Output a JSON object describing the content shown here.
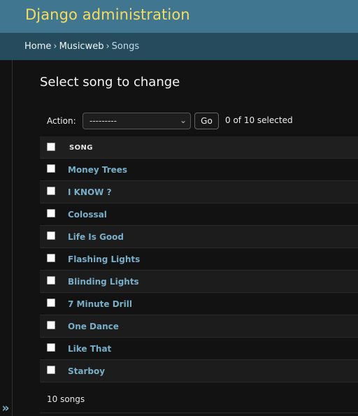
{
  "header": {
    "site_title": "Django administration"
  },
  "breadcrumbs": {
    "home": "Home",
    "sep1": "›",
    "app": "Musicweb",
    "sep2": "›",
    "current": "Songs"
  },
  "sidebar": {
    "toggle_glyph": "»"
  },
  "page": {
    "title": "Select song to change"
  },
  "actions": {
    "label": "Action:",
    "selected_option": "---------",
    "go_label": "Go",
    "selection_counter": "0 of 10 selected"
  },
  "table": {
    "column_header": "SONG",
    "rows": [
      {
        "title": "Money Trees"
      },
      {
        "title": "I KNOW ?"
      },
      {
        "title": "Colossal"
      },
      {
        "title": "Life Is Good"
      },
      {
        "title": "Flashing Lights"
      },
      {
        "title": "Blinding Lights"
      },
      {
        "title": "7 Minute Drill"
      },
      {
        "title": "One Dance"
      },
      {
        "title": "Like That"
      },
      {
        "title": "Starboy"
      }
    ]
  },
  "paginator": {
    "text": "10 songs"
  },
  "colors": {
    "header_bg": "#417690",
    "brand_text": "#f5dd5d",
    "breadcrumb_bg": "#264b5d",
    "link": "#79aec8",
    "body_bg": "#121212"
  }
}
